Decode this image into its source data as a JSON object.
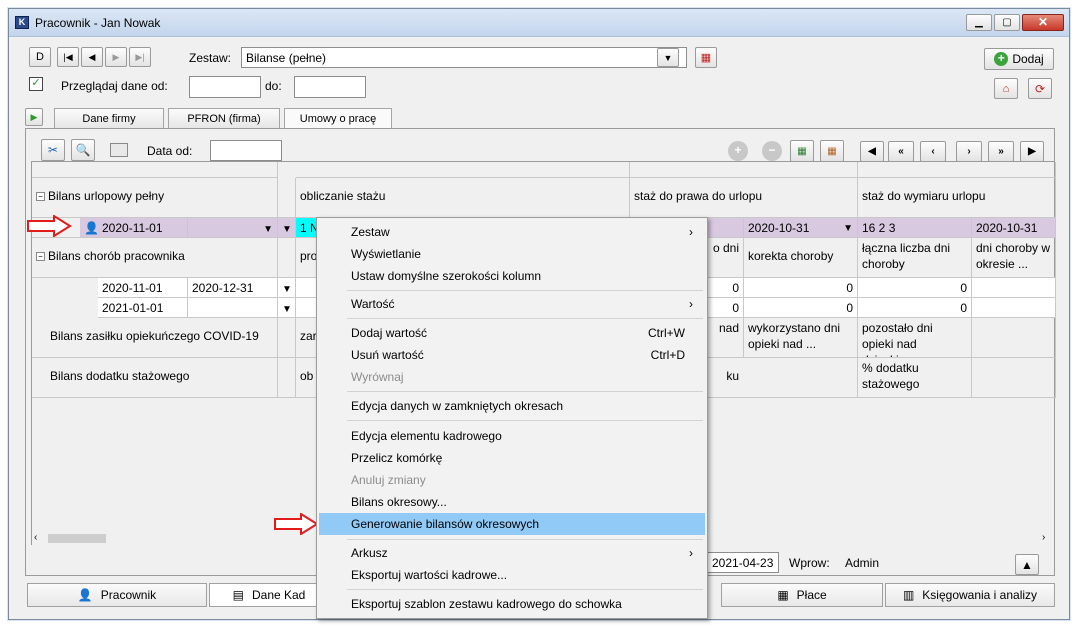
{
  "window": {
    "title": "Pracownik - Jan Nowak"
  },
  "toolbar": {
    "zestaw_label": "Zestaw:",
    "zestaw_value": "Bilanse (pełne)",
    "add_label": "Dodaj",
    "przegladaj_label": "Przeglądaj dane od:",
    "do_label": "do:",
    "od_value": "",
    "do_value": ""
  },
  "tabs": [
    "Dane firmy",
    "PFRON (firma)",
    "Umowy o pracę"
  ],
  "grid_toolbar": {
    "data_od_label": "Data od:",
    "data_od_value": ""
  },
  "grid": {
    "col_headers": [
      "obliczanie stażu",
      "staż do prawa do urlopu",
      "staż do wymiaru urlopu"
    ],
    "groups": [
      {
        "label": "Bilans urlopowy pełny"
      },
      {
        "label": "Bilans chorób pracownika"
      },
      {
        "label": "Bilans zasiłku opiekuńczego COVID-19"
      },
      {
        "label": "Bilans dodatku stażowego"
      }
    ],
    "row1": {
      "date1": "2020-11-01",
      "cyan_value": "1 N",
      "date2": "2020-10-31",
      "staz": "16  2  3",
      "date3": "2020-10-31"
    },
    "chorob_headers": {
      "c1": "pro",
      "c2": "o dni",
      "c3": "korekta choroby",
      "c4": "łączna liczba dni choroby",
      "c5": "dni choroby w okresie ..."
    },
    "chorob_rows": [
      {
        "d1": "2020-11-01",
        "d2": "2020-12-31",
        "v1": "0",
        "v2": "0",
        "v3": "0"
      },
      {
        "d1": "2021-01-01",
        "d2": "",
        "v1": "0",
        "v2": "0",
        "v3": "0"
      }
    ],
    "covid_headers": {
      "c1": "zar",
      "c2": "nad",
      "c3": "wykorzystano dni opieki nad ...",
      "c4": "pozostało dni opieki nad dzieckiem ..."
    },
    "staz_headers": {
      "c1": "ob",
      "c2": "ku",
      "c4": "% dodatku stażowego"
    }
  },
  "status": {
    "date": "2021-04-23",
    "wprow_label": "Wprow:",
    "wprow_value": "Admin"
  },
  "bottom_tabs": [
    "Pracownik",
    "Dane Kad",
    "Płace",
    "Księgowania i analizy"
  ],
  "context_menu": {
    "items": [
      {
        "label": "Zestaw",
        "submenu": true
      },
      {
        "label": "Wyświetlanie"
      },
      {
        "label": "Ustaw domyślne szerokości kolumn"
      },
      {
        "label": "Wartość",
        "submenu": true
      },
      {
        "label": "Dodaj wartość",
        "shortcut": "Ctrl+W"
      },
      {
        "label": "Usuń wartość",
        "shortcut": "Ctrl+D"
      },
      {
        "label": "Wyrównaj",
        "disabled": true
      },
      {
        "label": "Edycja danych w zamkniętych okresach"
      },
      {
        "label": "Edycja elementu kadrowego"
      },
      {
        "label": "Przelicz komórkę"
      },
      {
        "label": "Anuluj zmiany",
        "disabled": true
      },
      {
        "label": "Bilans okresowy..."
      },
      {
        "label": "Generowanie bilansów okresowych",
        "highlighted": true
      },
      {
        "label": "Arkusz",
        "submenu": true
      },
      {
        "label": "Eksportuj wartości kadrowe..."
      },
      {
        "label": "Eksportuj szablon zestawu kadrowego do schowka"
      }
    ]
  },
  "colors": {
    "highlight": "#91c9f7",
    "selected_row": "#d9c9e0",
    "arrow": "#e21b1b",
    "cyan": "#00ffff"
  }
}
